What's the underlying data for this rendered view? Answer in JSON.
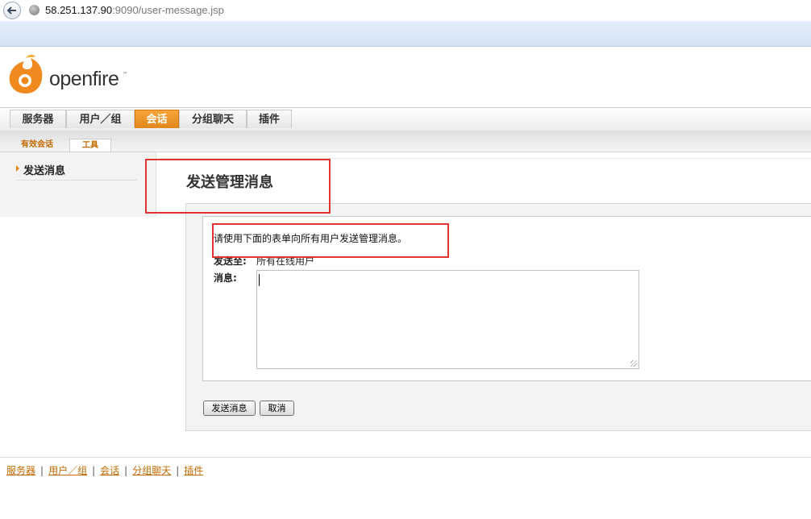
{
  "browser": {
    "url_host": "58.251.137.90",
    "url_path": ":9090/user-message.jsp"
  },
  "logo": {
    "text": "openfire",
    "tm": "™"
  },
  "main_nav": {
    "tabs": [
      {
        "label": "服务器",
        "active": false
      },
      {
        "label": "用户／组",
        "active": false
      },
      {
        "label": "会话",
        "active": true
      },
      {
        "label": "分组聊天",
        "active": false
      },
      {
        "label": "插件",
        "active": false
      }
    ]
  },
  "sub_nav": {
    "tabs": [
      {
        "label": "有效会话",
        "active": false
      },
      {
        "label": "工具",
        "active": true
      }
    ]
  },
  "sidebar": {
    "items": [
      {
        "label": "发送消息",
        "active": true
      }
    ]
  },
  "page": {
    "title": "发送管理消息",
    "intro": "请使用下面的表单向所有用户发送管理消息。",
    "to_label": "发送至:",
    "to_value": "所有在线用户",
    "message_label": "消息:",
    "message_value": "",
    "send_button": "发送消息",
    "cancel_button": "取消"
  },
  "footer": {
    "links": [
      "服务器",
      "用户／组",
      "会话",
      "分组聊天",
      "插件"
    ]
  },
  "colors": {
    "accent": "#e28b10",
    "annotation": "#e0352f",
    "link": "#c26a00"
  }
}
